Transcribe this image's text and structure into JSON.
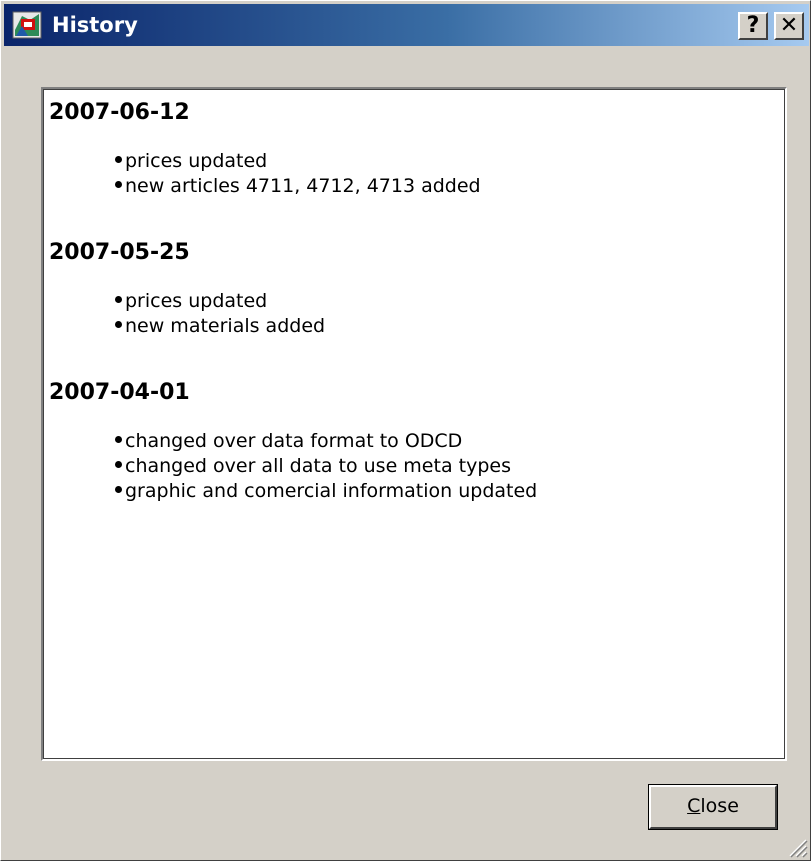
{
  "window": {
    "title": "History",
    "help_button_label": "?",
    "close_button_label": "✕"
  },
  "history": [
    {
      "date": "2007-06-12",
      "items": [
        "prices updated",
        "new articles 4711, 4712, 4713 added"
      ]
    },
    {
      "date": "2007-05-25",
      "items": [
        "prices updated",
        "new materials added"
      ]
    },
    {
      "date": "2007-04-01",
      "items": [
        "changed over data format to ODCD",
        "changed over all data to use meta types",
        "graphic and comercial information updated"
      ]
    }
  ],
  "footer": {
    "close_label_mnemonic": "C",
    "close_label_rest": "lose"
  },
  "icons": {
    "app": "history-app-icon",
    "resize": "resize-grip-icon"
  },
  "colors": {
    "titlebar_start": "#0a246a",
    "titlebar_end": "#a6caf0",
    "dialog_face": "#d4d0c8",
    "content_bg": "#ffffff"
  }
}
